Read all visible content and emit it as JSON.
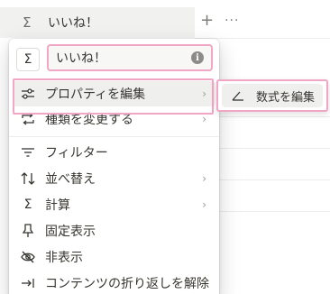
{
  "column": {
    "icon": "sigma-icon",
    "title": "いいね！"
  },
  "header_actions": {
    "add": "+",
    "more": "···"
  },
  "menu": {
    "type_icon": "sigma-icon",
    "name_value": "いいね！",
    "info_icon": "info-icon",
    "items": [
      {
        "label": "プロパティを編集",
        "icon": "sliders-icon",
        "has_submenu": true
      },
      {
        "label": "種類を変更する",
        "icon": "change-type-icon",
        "has_submenu": true
      },
      {
        "label": "フィルター",
        "icon": "filter-icon",
        "has_submenu": false
      },
      {
        "label": "並べ替え",
        "icon": "sort-icon",
        "has_submenu": true
      },
      {
        "label": "計算",
        "icon": "sigma-icon",
        "has_submenu": true
      },
      {
        "label": "固定表示",
        "icon": "pin-icon",
        "has_submenu": false
      },
      {
        "label": "非表示",
        "icon": "eye-off-icon",
        "has_submenu": false
      },
      {
        "label": "コンテンツの折り返しを解除",
        "icon": "wrap-icon",
        "has_submenu": false
      }
    ]
  },
  "submenu": {
    "items": [
      {
        "label": "数式を編集",
        "icon": "formula-edit-icon"
      }
    ]
  },
  "colors": {
    "highlight": "#f0a6c4",
    "hover_bg": "#efefed",
    "text": "#37352f"
  }
}
